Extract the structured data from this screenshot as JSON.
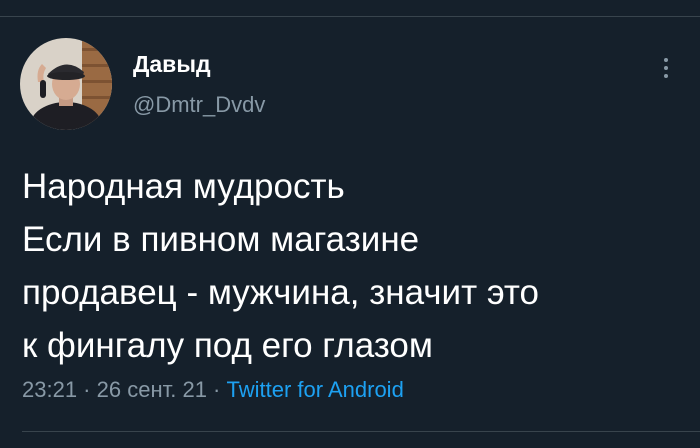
{
  "tweet": {
    "author": {
      "display_name": "Давыд",
      "handle": "@Dmtr_Dvdv"
    },
    "text_lines": [
      "Народная мудрость",
      "Если в пивном магазине",
      "продавец - мужчина, значит это",
      "к фингалу под его глазом"
    ],
    "meta": {
      "time": "23:21",
      "separator": " · ",
      "date": "26 сент. 21",
      "source": "Twitter for Android"
    }
  },
  "icons": {
    "more": "more-vertical-icon"
  },
  "colors": {
    "background": "#15202b",
    "primary_text": "#ffffff",
    "secondary_text": "#8899a6",
    "link": "#1da1f2",
    "divider": "#38444d"
  }
}
